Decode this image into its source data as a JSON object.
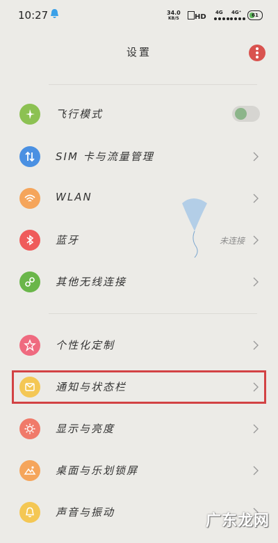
{
  "status_bar": {
    "time": "10:27",
    "speed_value": "34.0",
    "speed_unit": "KB/S",
    "hd_label": "HD",
    "net1": "4G",
    "net2": "4G⁺",
    "battery": "61"
  },
  "header": {
    "title": "设置"
  },
  "settings": {
    "airplane_mode": {
      "label": "飞行模式",
      "enabled": false
    },
    "sim": {
      "label": "SIM 卡与流量管理"
    },
    "wlan": {
      "label": "WLAN"
    },
    "bluetooth": {
      "label": "蓝牙",
      "value": "未连接"
    },
    "other_connections": {
      "label": "其他无线连接"
    },
    "personalization": {
      "label": "个性化定制"
    },
    "notification_status_bar": {
      "label": "通知与状态栏"
    },
    "display_brightness": {
      "label": "显示与亮度"
    },
    "desktop_lockscreen": {
      "label": "桌面与乐划锁屏"
    },
    "sound_vibration": {
      "label": "声音与振动"
    }
  },
  "icon_colors": {
    "airplane": "#8cc152",
    "sim": "#4a90e2",
    "wlan": "#f5a55b",
    "bluetooth": "#ef5b5b",
    "other": "#6ab64a",
    "personalization": "#ef6a7f",
    "notification": "#f4c754",
    "display": "#f07a6a",
    "desktop": "#f5a55b",
    "sound": "#f4c754"
  },
  "watermark": "广东龙网"
}
